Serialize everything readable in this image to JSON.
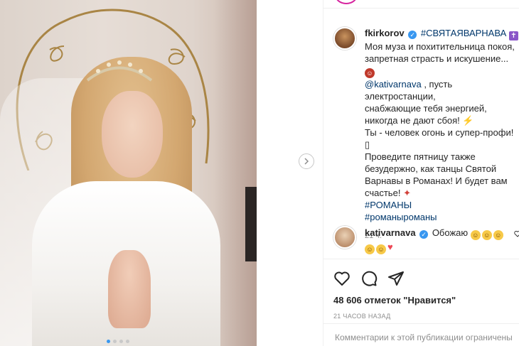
{
  "post": {
    "author": "fkirkorov",
    "hashtag_title": "#СВЯТАЯВАРНАВА",
    "caption_lines": [
      "Моя муза и похитительница покоя,",
      "запретная страсть и искушение...",
      "@kativarnava",
      ", пусть электростанции,",
      "снабжающие тебя энергией,",
      "никогда не дают сбоя!",
      "Ты - человек огонь и супер-профи!",
      "Проведите пятницу также",
      "безудержно, как танцы Святой",
      "Варнавы в Романах! И будет вам",
      "счастье!"
    ],
    "hashtags": [
      "#РОМАНЫ",
      "#романыроманы"
    ],
    "time_ago": "21 ч.",
    "likes": "48 606 отметок \"Нравится\"",
    "posted": "21 ЧАСОВ НАЗАД",
    "comments_disabled": "Комментарии к этой публикации ограничены"
  },
  "comment": {
    "author": "kativarnava",
    "text": "Обожаю"
  },
  "icons": {
    "like": "heart-outline-icon",
    "comment": "speech-bubble-icon",
    "share": "paper-plane-icon",
    "next": "chevron-right-icon",
    "verified": "verified-badge-icon"
  },
  "colors": {
    "link": "#00376b",
    "verified": "#3897f0",
    "muted": "#8e8e8e"
  },
  "carousel": {
    "total": 4,
    "active": 1
  }
}
